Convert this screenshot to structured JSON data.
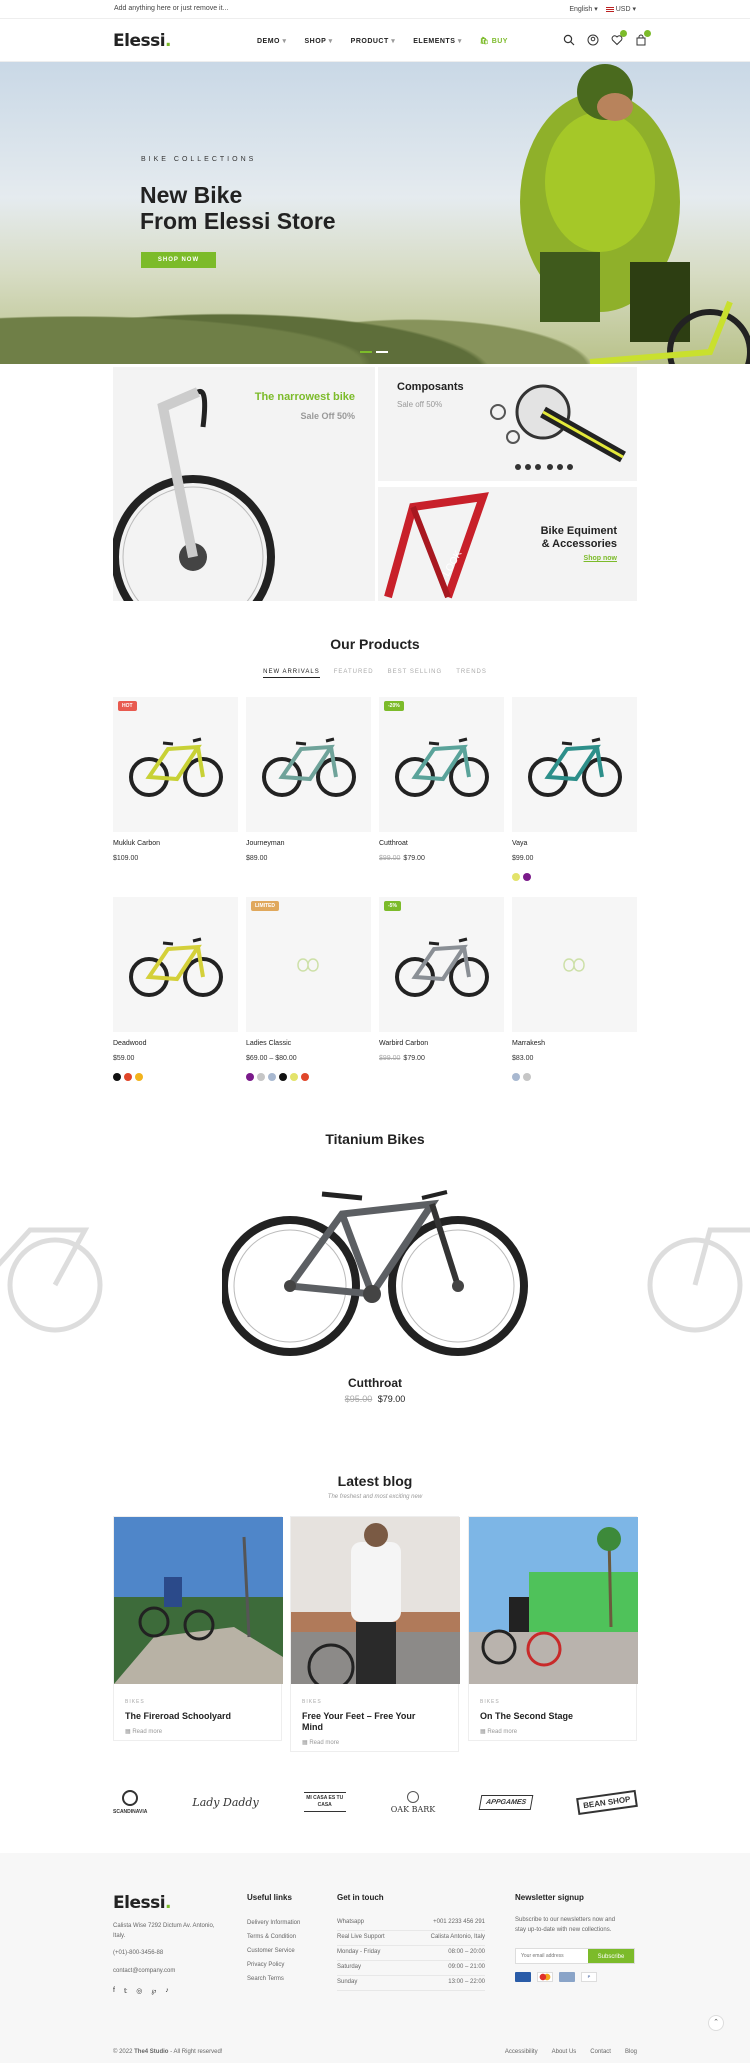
{
  "topbar": {
    "message": "Add anything here or just remove it...",
    "language": "English",
    "currency": "USD"
  },
  "header": {
    "logo": "Elessi",
    "logo_dot": ".",
    "nav": [
      "DEMO",
      "SHOP",
      "PRODUCT",
      "ELEMENTS",
      "BUY"
    ],
    "icons": [
      "search-icon",
      "user-icon",
      "heart-icon",
      "cart-icon"
    ]
  },
  "hero": {
    "eyebrow": "BIKE COLLECTIONS",
    "title_line1": "New Bike",
    "title_line2": "From Elessi Store",
    "cta": "SHOP NOW"
  },
  "promos": {
    "narrowest": {
      "title": "The narrowest bike",
      "subtitle": "Sale Off 50%"
    },
    "composants": {
      "title": "Composants",
      "subtitle": "Sale off 50%"
    },
    "equipment": {
      "title_line1": "Bike Equiment",
      "title_line2": "& Accessories",
      "link": "Shop now"
    }
  },
  "products_section": {
    "title": "Our Products",
    "tabs": [
      "NEW ARRIVALS",
      "FEATURED",
      "BEST SELLING",
      "TRENDS"
    ],
    "items": [
      {
        "name": "Mukluk Carbon",
        "price": "$109.00",
        "old": "",
        "tag": "HOT",
        "tag_color": "#e85a4f",
        "frame": "#c8d136"
      },
      {
        "name": "Journeyman",
        "price": "$89.00",
        "old": "",
        "tag": "",
        "tag_color": "",
        "frame": "#6fa39a"
      },
      {
        "name": "Cutthroat",
        "price": "$79.00",
        "old": "$99.00",
        "tag": "-20%",
        "tag_color": "#7cbb2a",
        "frame": "#5aa39a"
      },
      {
        "name": "Vaya",
        "price": "$99.00",
        "old": "",
        "tag": "",
        "tag_color": "",
        "frame": "#2d8f8a"
      },
      {
        "name": "Deadwood",
        "price": "$59.00",
        "old": "",
        "tag": "",
        "tag_color": "",
        "frame": "#d4d03a"
      },
      {
        "name": "Ladies Classic",
        "price": "$69.00 – $80.00",
        "old": "",
        "tag": "LIMITED",
        "tag_color": "#e0a85c",
        "frame": ""
      },
      {
        "name": "Warbird Carbon",
        "price": "$79.00",
        "old": "$99.00",
        "tag": "-5%",
        "tag_color": "#7cbb2a",
        "frame": "#8a8f95"
      },
      {
        "name": "Marrakesh",
        "price": "$83.00",
        "old": "",
        "tag": "",
        "tag_color": "",
        "frame": ""
      }
    ],
    "swatches": {
      "vaya": [
        "#e3e36a",
        "#7a1a8a"
      ],
      "deadwood": [
        "#111111",
        "#e0462a",
        "#f2b31c"
      ],
      "ladies": [
        "#7a1a8a",
        "#c6c6c6",
        "#a8b8d0",
        "#111111",
        "#e3e36a",
        "#e0462a"
      ],
      "marrakesh": [
        "#a8b8d0",
        "#c6c6c6"
      ]
    }
  },
  "titanium": {
    "title": "Titanium Bikes",
    "product": "Cutthroat",
    "old_price": "$95.00",
    "price": "$79.00"
  },
  "blog": {
    "title": "Latest blog",
    "subtitle": "The freshest and most exciting new",
    "posts": [
      {
        "category": "BIKES",
        "title": "The Fireroad Schoolyard",
        "more": "Read more"
      },
      {
        "category": "BIKES",
        "title_line1": "Free Your Feet – Free Your",
        "title_line2": "Mind",
        "more": "Read more"
      },
      {
        "category": "BIKES",
        "title": "On The Second Stage",
        "more": "Read more"
      }
    ]
  },
  "brands": [
    "SCANDINAVIA",
    "Lady Daddy",
    "MI CASA ES TU CASA",
    "OAK BARK",
    "APPGAMES",
    "BEAN SHOP"
  ],
  "footer": {
    "logo": "Elessi",
    "address_line1": "Calista Wise 7292 Dictum Av. Antonio,",
    "address_line2": "Italy.",
    "phone": "(+01)-800-3456-88",
    "email": "contact@company.com",
    "useful_title": "Useful links",
    "useful_links": [
      "Delivery Information",
      "Terms & Condition",
      "Customer Service",
      "Privacy Policy",
      "Search Terms"
    ],
    "touch_title": "Get in touch",
    "touch_rows": [
      [
        "Whatsapp",
        "+001 2233 456 291"
      ],
      [
        "Real Live Support",
        "Calista Antonio, Italy"
      ],
      [
        "Monday - Friday",
        "08:00 – 20:00"
      ],
      [
        "Saturday",
        "09:00 – 21:00"
      ],
      [
        "Sunday",
        "13:00 – 22:00"
      ]
    ],
    "newsletter_title": "Newsletter signup",
    "newsletter_text1": "Subscribe to our newsletters now and",
    "newsletter_text2": "stay up-to-date with new collections.",
    "email_placeholder": "Your email address",
    "subscribe": "Subscribe",
    "copyright_prefix": "© 2022 ",
    "copyright_brand": "The4 Studio",
    "copyright_suffix": " - All Right reserved!",
    "bottom_links": [
      "Accessibility",
      "About Us",
      "Contact",
      "Blog"
    ]
  }
}
